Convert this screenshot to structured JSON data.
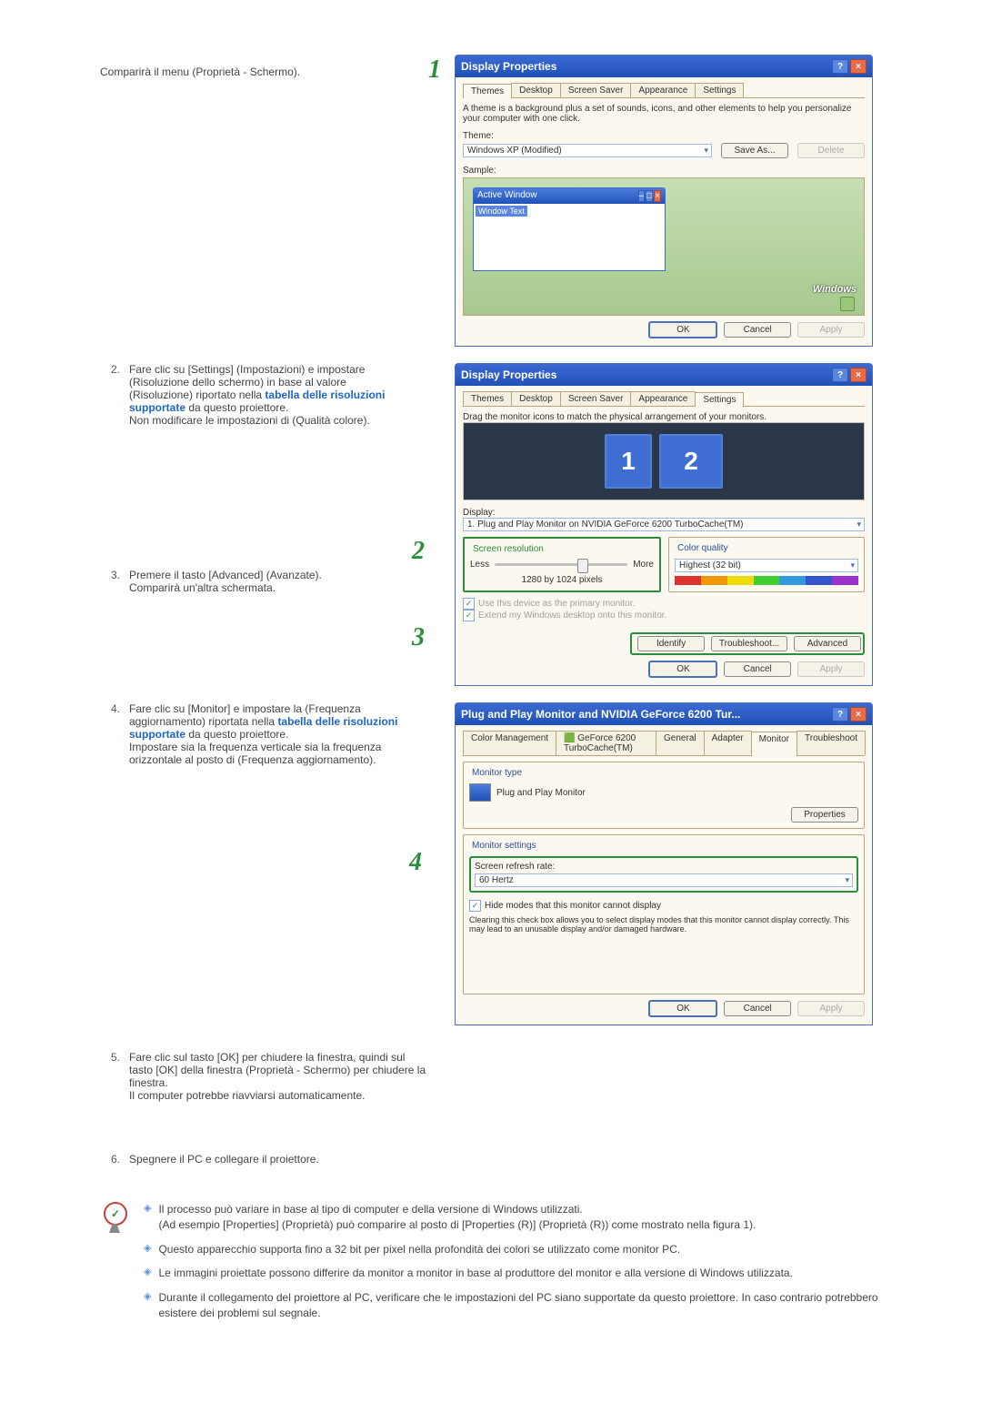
{
  "intro": "Comparirà il menu (Proprietà - Schermo).",
  "steps": [
    {
      "n": "2.",
      "text_a": "Fare clic su [Settings] (Impostazioni) e impostare (Risoluzione dello schermo) in base al valore (Risoluzione) riportato nella ",
      "link": "tabella delle risoluzioni supportate",
      "text_b": " da questo proiettore.",
      "text_c": "Non modificare le impostazioni di (Qualità colore)."
    },
    {
      "n": "3.",
      "text_a": "Premere il tasto [Advanced] (Avanzate).",
      "text_c": "Comparirà un'altra schermata."
    },
    {
      "n": "4.",
      "text_a": "Fare clic su [Monitor] e impostare la (Frequenza aggiornamento) riportata nella ",
      "link": "tabella delle risoluzioni supportate",
      "text_b": " da questo proiettore.",
      "text_c": "Impostare sia la frequenza verticale sia la frequenza orizzontale al posto di (Frequenza aggiornamento)."
    },
    {
      "n": "5.",
      "text_a": "Fare clic sul tasto [OK] per chiudere la finestra, quindi sul tasto [OK] della finestra (Proprietà - Schermo) per chiudere la finestra.",
      "text_c": "Il computer potrebbe riavviarsi automaticamente."
    },
    {
      "n": "6.",
      "text_a": "Spegnere il PC e collegare il proiettore."
    }
  ],
  "notes": [
    "Il processo può variare in base al tipo di computer e della versione di Windows utilizzati.\n(Ad esempio [Properties] (Proprietà) può comparire al posto di [Properties (R)] (Proprietà (R)) come mostrato nella figura 1).",
    "Questo apparecchio supporta fino a 32 bit per pixel nella profondità dei colori se utilizzato come monitor PC.",
    "Le immagini proiettate possono differire da monitor a monitor in base al produttore del monitor e alla versione di Windows utilizzata.",
    "Durante il collegamento del proiettore al PC, verificare che le impostazioni del PC siano supportate da questo proiettore. In caso contrario potrebbero esistere dei problemi sul segnale."
  ],
  "dlg1": {
    "title": "Display Properties",
    "tabs": [
      "Themes",
      "Desktop",
      "Screen Saver",
      "Appearance",
      "Settings"
    ],
    "active_tab": "Themes",
    "desc": "A theme is a background plus a set of sounds, icons, and other elements to help you personalize your computer with one click.",
    "theme_label": "Theme:",
    "theme_value": "Windows XP (Modified)",
    "save_as": "Save As...",
    "delete": "Delete",
    "sample_label": "Sample:",
    "active_window": "Active Window",
    "window_text": "Window Text",
    "logo": "Windows",
    "ok": "OK",
    "cancel": "Cancel",
    "apply": "Apply"
  },
  "dlg2": {
    "title": "Display Properties",
    "tabs": [
      "Themes",
      "Desktop",
      "Screen Saver",
      "Appearance",
      "Settings"
    ],
    "active_tab": "Settings",
    "instr": "Drag the monitor icons to match the physical arrangement of your monitors.",
    "display_label": "Display:",
    "display_value": "1. Plug and Play Monitor on NVIDIA GeForce 6200 TurboCache(TM)",
    "sr_legend": "Screen resolution",
    "less": "Less",
    "more": "More",
    "res_value": "1280 by 1024 pixels",
    "cq_legend": "Color quality",
    "cq_value": "Highest (32 bit)",
    "chk1": "Use this device as the primary monitor.",
    "chk2": "Extend my Windows desktop onto this monitor.",
    "identify": "Identify",
    "troubleshoot": "Troubleshoot...",
    "advanced": "Advanced",
    "ok": "OK",
    "cancel": "Cancel",
    "apply": "Apply",
    "callout2": "2",
    "callout3": "3",
    "mon1": "1",
    "mon2": "2"
  },
  "dlg3": {
    "title": "Plug and Play Monitor and NVIDIA GeForce 6200 Tur...",
    "tab_color": "Color Management",
    "tab_gf": "GeForce 6200 TurboCache(TM)",
    "tab_general": "General",
    "tab_adapter": "Adapter",
    "tab_monitor": "Monitor",
    "tab_trouble": "Troubleshoot",
    "mtype_legend": "Monitor type",
    "mtype_value": "Plug and Play Monitor",
    "properties": "Properties",
    "mset_legend": "Monitor settings",
    "refresh_label": "Screen refresh rate:",
    "refresh_value": "60 Hertz",
    "hide": "Hide modes that this monitor cannot display",
    "warn": "Clearing this check box allows you to select display modes that this monitor cannot display correctly. This may lead to an unusable display and/or damaged hardware.",
    "ok": "OK",
    "cancel": "Cancel",
    "apply": "Apply",
    "callout4": "4"
  },
  "callout1": "1"
}
